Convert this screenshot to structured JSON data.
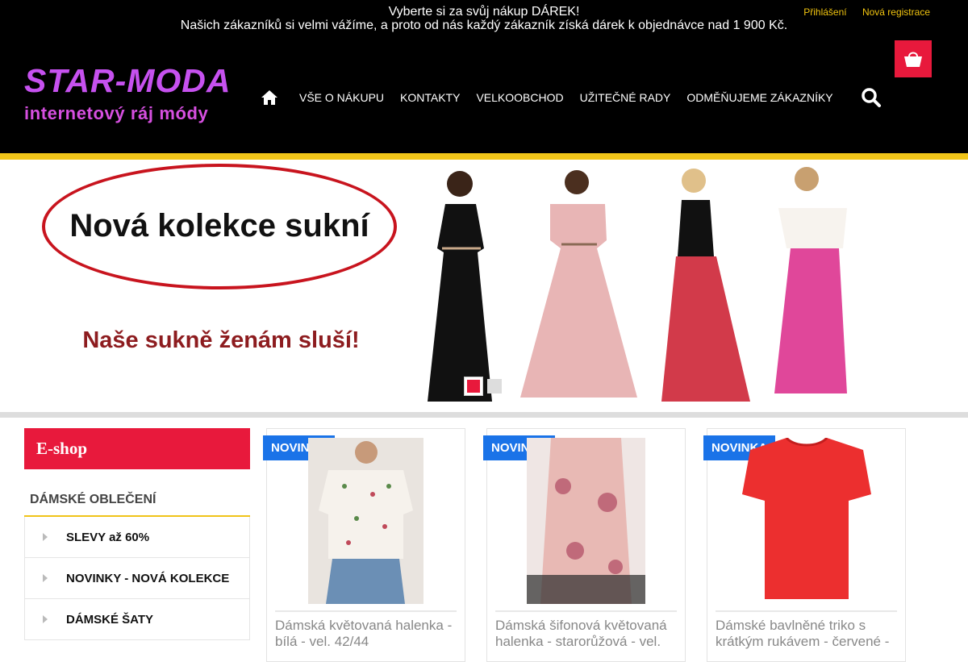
{
  "announcement": {
    "line1": " Vyberte si za svůj nákup DÁREK! ",
    "line2": "Našich zákazníků si velmi vážíme, a proto od nás každý zákazník získá dárek k objednávce nad 1 900 Kč."
  },
  "toplinks": {
    "login": "Přihlášení",
    "register": "Nová registrace"
  },
  "logo": {
    "name": "STAR-MODA",
    "tagline": "internetový ráj módy"
  },
  "nav": {
    "home_icon": "home-icon",
    "items": [
      "VŠE O NÁKUPU",
      "KONTAKTY",
      "VELKOOBCHOD",
      "UŽITEČNÉ RADY",
      "ODMĚŇUJEME ZÁKAZNÍKY"
    ]
  },
  "search_icon": "search-icon",
  "cart_icon": "shopping-bag-icon",
  "banner": {
    "headline": "Nová kolekce sukní",
    "subline": "Naše sukně ženám sluší!",
    "slides": 2,
    "active_slide": 1
  },
  "sidebar": {
    "title": "E-shop",
    "category_heading": "DÁMSKÉ OBLEČENÍ",
    "items": [
      "SLEVY až 60%",
      "NOVINKY - NOVÁ KOLEKCE",
      "DÁMSKÉ ŠATY"
    ]
  },
  "products": [
    {
      "badge": "NOVINKA",
      "title": "Dámská květovaná halenka - bílá - vel. 42/44"
    },
    {
      "badge": "NOVINKA",
      "title": "Dámská šifonová květovaná halenka - starorůžová - vel."
    },
    {
      "badge": "NOVINKA",
      "title": "Dámské bavlněné triko s krátkým rukávem - červené -"
    }
  ],
  "colors": {
    "header_bg": "#000000",
    "accent_red": "#e8193c",
    "accent_yellow": "#f0c419",
    "logo_purple": "#c651ef",
    "badge_blue": "#1a73e8"
  }
}
